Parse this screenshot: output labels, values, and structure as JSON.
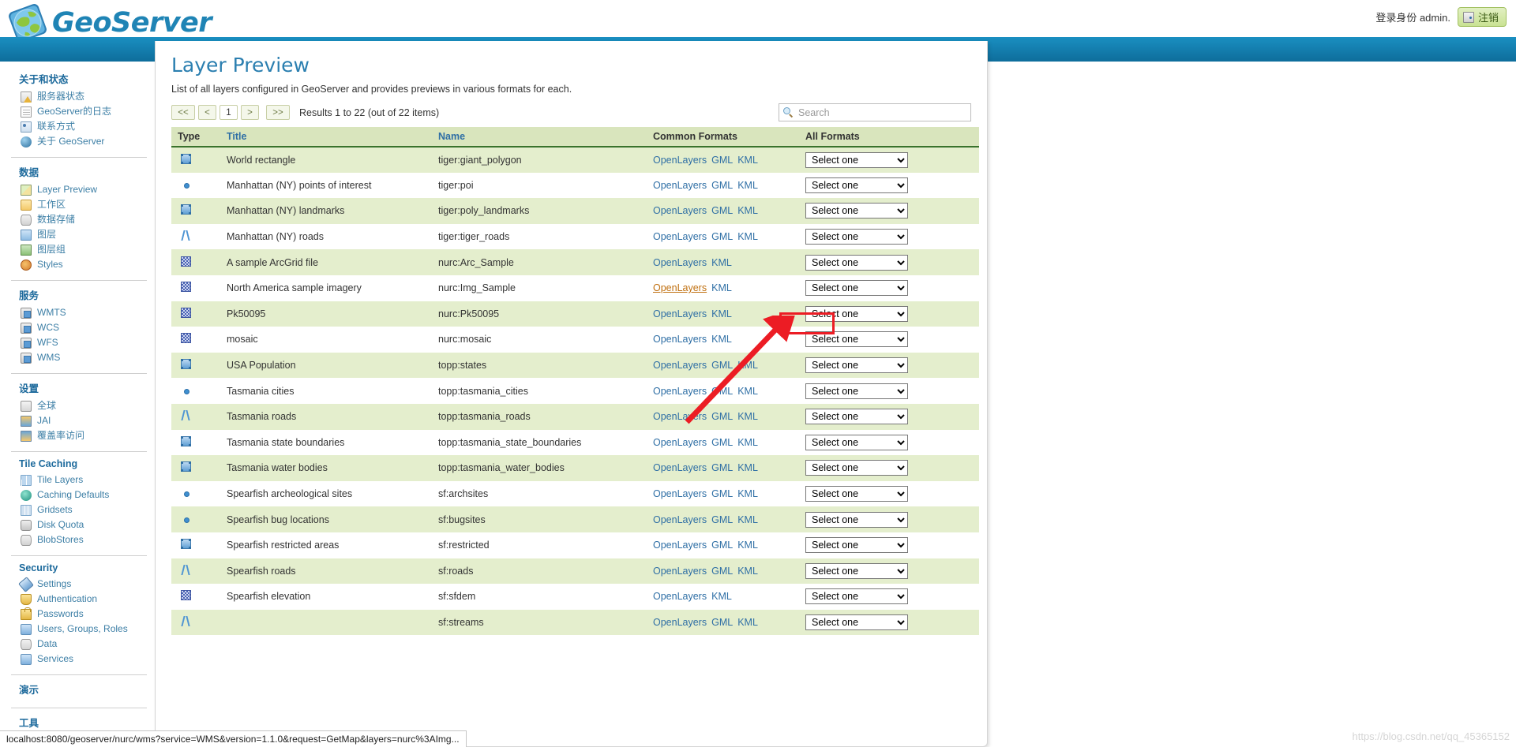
{
  "header": {
    "brand": "GeoServer",
    "logo_icon": "globe-icon",
    "login_text": "登录身份 admin.",
    "logout_label": "注销",
    "logout_icon": "door-exit-icon"
  },
  "sidebar": {
    "groups": [
      {
        "heading": "关于和状态",
        "items": [
          {
            "label": "服务器状态",
            "icon": "warning-status-icon"
          },
          {
            "label": "GeoServer的日志",
            "icon": "document-icon"
          },
          {
            "label": "联系方式",
            "icon": "contact-card-icon"
          },
          {
            "label": "关于 GeoServer",
            "icon": "info-globe-icon"
          }
        ]
      },
      {
        "heading": "数据",
        "items": [
          {
            "label": "Layer Preview",
            "icon": "layer-preview-icon"
          },
          {
            "label": "工作区",
            "icon": "folder-icon"
          },
          {
            "label": "数据存储",
            "icon": "database-icon"
          },
          {
            "label": "图层",
            "icon": "layer-icon"
          },
          {
            "label": "图层组",
            "icon": "layer-group-icon"
          },
          {
            "label": "Styles",
            "icon": "palette-icon"
          }
        ]
      },
      {
        "heading": "服务",
        "items": [
          {
            "label": "WMTS",
            "icon": "service-icon"
          },
          {
            "label": "WCS",
            "icon": "service-icon"
          },
          {
            "label": "WFS",
            "icon": "service-icon"
          },
          {
            "label": "WMS",
            "icon": "service-icon"
          }
        ]
      },
      {
        "heading": "设置",
        "items": [
          {
            "label": "全球",
            "icon": "global-settings-icon"
          },
          {
            "label": "JAI",
            "icon": "jai-icon"
          },
          {
            "label": "覆盖率访问",
            "icon": "coverage-access-icon"
          }
        ]
      },
      {
        "heading": "Tile Caching",
        "items": [
          {
            "label": "Tile Layers",
            "icon": "tile-layers-icon"
          },
          {
            "label": "Caching Defaults",
            "icon": "caching-globe-icon"
          },
          {
            "label": "Gridsets",
            "icon": "gridsets-icon"
          },
          {
            "label": "Disk Quota",
            "icon": "disk-icon"
          },
          {
            "label": "BlobStores",
            "icon": "blobstore-icon"
          }
        ]
      },
      {
        "heading": "Security",
        "items": [
          {
            "label": "Settings",
            "icon": "wrench-icon"
          },
          {
            "label": "Authentication",
            "icon": "shield-icon"
          },
          {
            "label": "Passwords",
            "icon": "lock-icon"
          },
          {
            "label": "Users, Groups, Roles",
            "icon": "users-icon"
          },
          {
            "label": "Data",
            "icon": "data-icon"
          },
          {
            "label": "Services",
            "icon": "services-icon"
          }
        ]
      },
      {
        "heading": "演示",
        "items": []
      },
      {
        "heading": "工具",
        "items": []
      }
    ]
  },
  "main": {
    "title": "Layer Preview",
    "description": "List of all layers configured in GeoServer and provides previews in various formats for each.",
    "pager": {
      "first": "<<",
      "prev": "<",
      "current_page": "1",
      "next": ">",
      "last": ">>",
      "results_text": "Results 1 to 22 (out of 22 items)"
    },
    "search": {
      "placeholder": "Search",
      "value": "",
      "icon": "search-icon"
    },
    "table": {
      "headers": {
        "type": "Type",
        "title": "Title",
        "name": "Name",
        "common_formats": "Common Formats",
        "all_formats": "All Formats"
      },
      "select_placeholder": "Select one",
      "rows": [
        {
          "geom": "polygon",
          "title": "World rectangle",
          "name": "tiger:giant_polygon",
          "formats": [
            "OpenLayers",
            "GML",
            "KML"
          ],
          "select": "Select one"
        },
        {
          "geom": "point",
          "title": "Manhattan (NY) points of interest",
          "name": "tiger:poi",
          "formats": [
            "OpenLayers",
            "GML",
            "KML"
          ],
          "select": "Select one"
        },
        {
          "geom": "polygon",
          "title": "Manhattan (NY) landmarks",
          "name": "tiger:poly_landmarks",
          "formats": [
            "OpenLayers",
            "GML",
            "KML"
          ],
          "select": "Select one"
        },
        {
          "geom": "line",
          "title": "Manhattan (NY) roads",
          "name": "tiger:tiger_roads",
          "formats": [
            "OpenLayers",
            "GML",
            "KML"
          ],
          "select": "Select one"
        },
        {
          "geom": "raster",
          "title": "A sample ArcGrid file",
          "name": "nurc:Arc_Sample",
          "formats": [
            "OpenLayers",
            "KML"
          ],
          "select": "Select one"
        },
        {
          "geom": "raster",
          "title": "North America sample imagery",
          "name": "nurc:Img_Sample",
          "formats": [
            "OpenLayers",
            "KML"
          ],
          "select": "Select one",
          "hovered_format": "OpenLayers"
        },
        {
          "geom": "raster",
          "title": "Pk50095",
          "name": "nurc:Pk50095",
          "formats": [
            "OpenLayers",
            "KML"
          ],
          "select": "Select one"
        },
        {
          "geom": "raster",
          "title": "mosaic",
          "name": "nurc:mosaic",
          "formats": [
            "OpenLayers",
            "KML"
          ],
          "select": "Select one"
        },
        {
          "geom": "polygon",
          "title": "USA Population",
          "name": "topp:states",
          "formats": [
            "OpenLayers",
            "GML",
            "KML"
          ],
          "select": "Select one"
        },
        {
          "geom": "point",
          "title": "Tasmania cities",
          "name": "topp:tasmania_cities",
          "formats": [
            "OpenLayers",
            "GML",
            "KML"
          ],
          "select": "Select one"
        },
        {
          "geom": "line",
          "title": "Tasmania roads",
          "name": "topp:tasmania_roads",
          "formats": [
            "OpenLayers",
            "GML",
            "KML"
          ],
          "select": "Select one"
        },
        {
          "geom": "polygon",
          "title": "Tasmania state boundaries",
          "name": "topp:tasmania_state_boundaries",
          "formats": [
            "OpenLayers",
            "GML",
            "KML"
          ],
          "select": "Select one"
        },
        {
          "geom": "polygon",
          "title": "Tasmania water bodies",
          "name": "topp:tasmania_water_bodies",
          "formats": [
            "OpenLayers",
            "GML",
            "KML"
          ],
          "select": "Select one"
        },
        {
          "geom": "point",
          "title": "Spearfish archeological sites",
          "name": "sf:archsites",
          "formats": [
            "OpenLayers",
            "GML",
            "KML"
          ],
          "select": "Select one"
        },
        {
          "geom": "point",
          "title": "Spearfish bug locations",
          "name": "sf:bugsites",
          "formats": [
            "OpenLayers",
            "GML",
            "KML"
          ],
          "select": "Select one"
        },
        {
          "geom": "polygon",
          "title": "Spearfish restricted areas",
          "name": "sf:restricted",
          "formats": [
            "OpenLayers",
            "GML",
            "KML"
          ],
          "select": "Select one"
        },
        {
          "geom": "line",
          "title": "Spearfish roads",
          "name": "sf:roads",
          "formats": [
            "OpenLayers",
            "GML",
            "KML"
          ],
          "select": "Select one"
        },
        {
          "geom": "raster",
          "title": "Spearfish elevation",
          "name": "sf:sfdem",
          "formats": [
            "OpenLayers",
            "KML"
          ],
          "select": "Select one"
        },
        {
          "geom": "line",
          "title": "",
          "name": "sf:streams",
          "formats": [
            "OpenLayers",
            "GML",
            "KML"
          ],
          "select": "Select one"
        }
      ]
    }
  },
  "status_bar": {
    "url": "localhost:8080/geoserver/nurc/wms?service=WMS&version=1.1.0&request=GetMap&layers=nurc%3AImg..."
  },
  "watermark": "https://blog.csdn.net/qq_45365152",
  "annotations": {
    "highlight_color": "#ec1c24",
    "highlight_target": "OpenLayers"
  }
}
